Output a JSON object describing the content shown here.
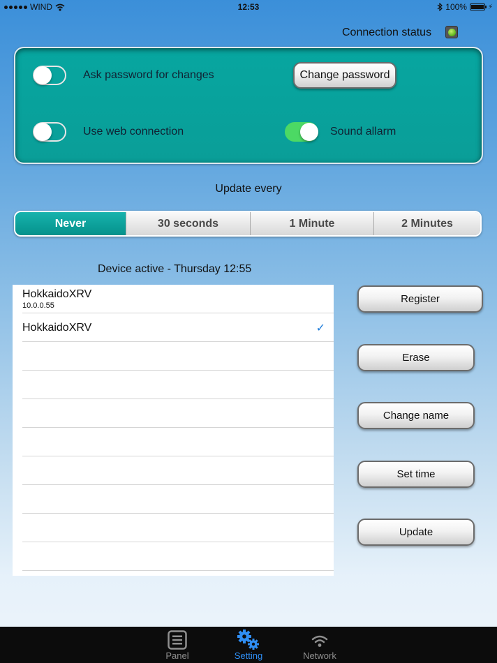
{
  "status_bar": {
    "carrier": "WIND",
    "time": "12:53",
    "battery": "100%"
  },
  "connection": {
    "label": "Connection status",
    "state": "connected"
  },
  "settings": {
    "ask_password": {
      "label": "Ask password for changes",
      "on": false
    },
    "change_password": "Change password",
    "web_connection": {
      "label": "Use web connection",
      "on": false
    },
    "sound_alarm": {
      "label": "Sound allarm",
      "on": true
    }
  },
  "update": {
    "title": "Update every",
    "options": [
      "Never",
      "30 seconds",
      "1 Minute",
      "2 Minutes"
    ],
    "selected": "Never"
  },
  "devices": {
    "active_label": "Device active - Thursday 12:55",
    "items": [
      {
        "name": "HokkaidoXRV",
        "ip": "10.0.0.55",
        "checked": false
      },
      {
        "name": "HokkaidoXRV",
        "ip": "",
        "checked": true
      }
    ],
    "checkmark": "✓"
  },
  "actions": {
    "register": "Register",
    "erase": "Erase",
    "change_name": "Change name",
    "set_time": "Set time",
    "update": "Update"
  },
  "tabs": [
    {
      "label": "Panel",
      "icon": "panel-icon",
      "active": false
    },
    {
      "label": "Setting",
      "icon": "gears-icon",
      "active": true
    },
    {
      "label": "Network",
      "icon": "wifi-icon",
      "active": false
    }
  ],
  "colors": {
    "accent": "#2f8ef3",
    "panel": "#0aa39d",
    "toggle_on": "#4cd964"
  }
}
